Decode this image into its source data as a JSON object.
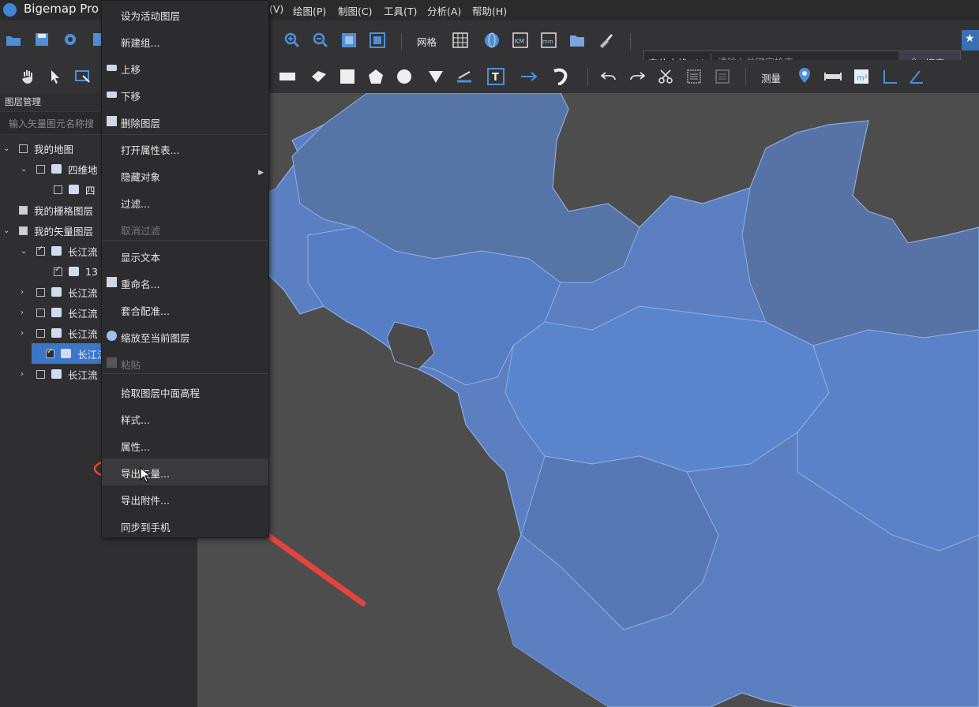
{
  "app": {
    "title": "Bigemap Pro"
  },
  "menubar": {
    "items": [
      "(V)",
      "绘图(P)",
      "制图(C)",
      "工具(T)",
      "分析(A)",
      "帮助(H)"
    ]
  },
  "toolbar": {
    "grid_label": "网格",
    "locate_label": "定位查找",
    "search_placeholder": "请输入关键字检索",
    "search_button": "搜索",
    "measure_label": "测量",
    "km_label": "KM",
    "mm_label": "mm"
  },
  "panel": {
    "title": "图层管理",
    "search_placeholder": "输入矢量图元名称搜",
    "tree": [
      {
        "label": "我的地图",
        "level": 0,
        "arrow": "down",
        "check": "off"
      },
      {
        "label": "四维地",
        "level": 1,
        "arrow": "down",
        "check": "off"
      },
      {
        "label": "四",
        "level": 2,
        "arrow": "",
        "check": "off"
      },
      {
        "label": "我的栅格图层",
        "level": 0,
        "arrow": "",
        "check": "fill"
      },
      {
        "label": "我的矢量图层",
        "level": 0,
        "arrow": "down",
        "check": "fill"
      },
      {
        "label": "长江流",
        "level": 1,
        "arrow": "down",
        "check": "on"
      },
      {
        "label": "13",
        "level": 2,
        "arrow": "",
        "check": "on"
      },
      {
        "label": "长江流",
        "level": 1,
        "arrow": "right",
        "check": "off"
      },
      {
        "label": "长江流",
        "level": 1,
        "arrow": "right",
        "check": "off"
      },
      {
        "label": "长江流",
        "level": 1,
        "arrow": "right",
        "check": "off"
      },
      {
        "label": "长江流",
        "level": 1,
        "arrow": "right",
        "check": "on",
        "selected": true
      },
      {
        "label": "长江流",
        "level": 1,
        "arrow": "right",
        "check": "off"
      }
    ]
  },
  "context_menu": {
    "items": [
      {
        "label": "设为活动图层",
        "disabled": false
      },
      {
        "label": "新建组...",
        "disabled": false
      },
      {
        "label": "上移",
        "disabled": false
      },
      {
        "label": "下移",
        "disabled": false
      },
      {
        "label": "删除图层",
        "disabled": false
      },
      {
        "label": "打开属性表...",
        "disabled": false
      },
      {
        "label": "隐藏对象",
        "disabled": false,
        "submenu": true
      },
      {
        "label": "过滤...",
        "disabled": false
      },
      {
        "label": "取消过滤",
        "disabled": true
      },
      {
        "label": "显示文本",
        "disabled": false
      },
      {
        "label": "重命名...",
        "disabled": false
      },
      {
        "label": "套合配准...",
        "disabled": false
      },
      {
        "label": "缩放至当前图层",
        "disabled": false
      },
      {
        "label": "粘贴",
        "disabled": true
      },
      {
        "label": "拾取图层中面高程",
        "disabled": false
      },
      {
        "label": "样式...",
        "disabled": false
      },
      {
        "label": "属性...",
        "disabled": false
      },
      {
        "label": "导出矢量...",
        "disabled": false,
        "highlighted": true
      },
      {
        "label": "导出附件...",
        "disabled": false
      },
      {
        "label": "同步到手机",
        "disabled": false
      }
    ]
  },
  "colors": {
    "accent": "#3b76c9",
    "map_fill": "#5b7fc0",
    "annotation": "#e8423c"
  }
}
